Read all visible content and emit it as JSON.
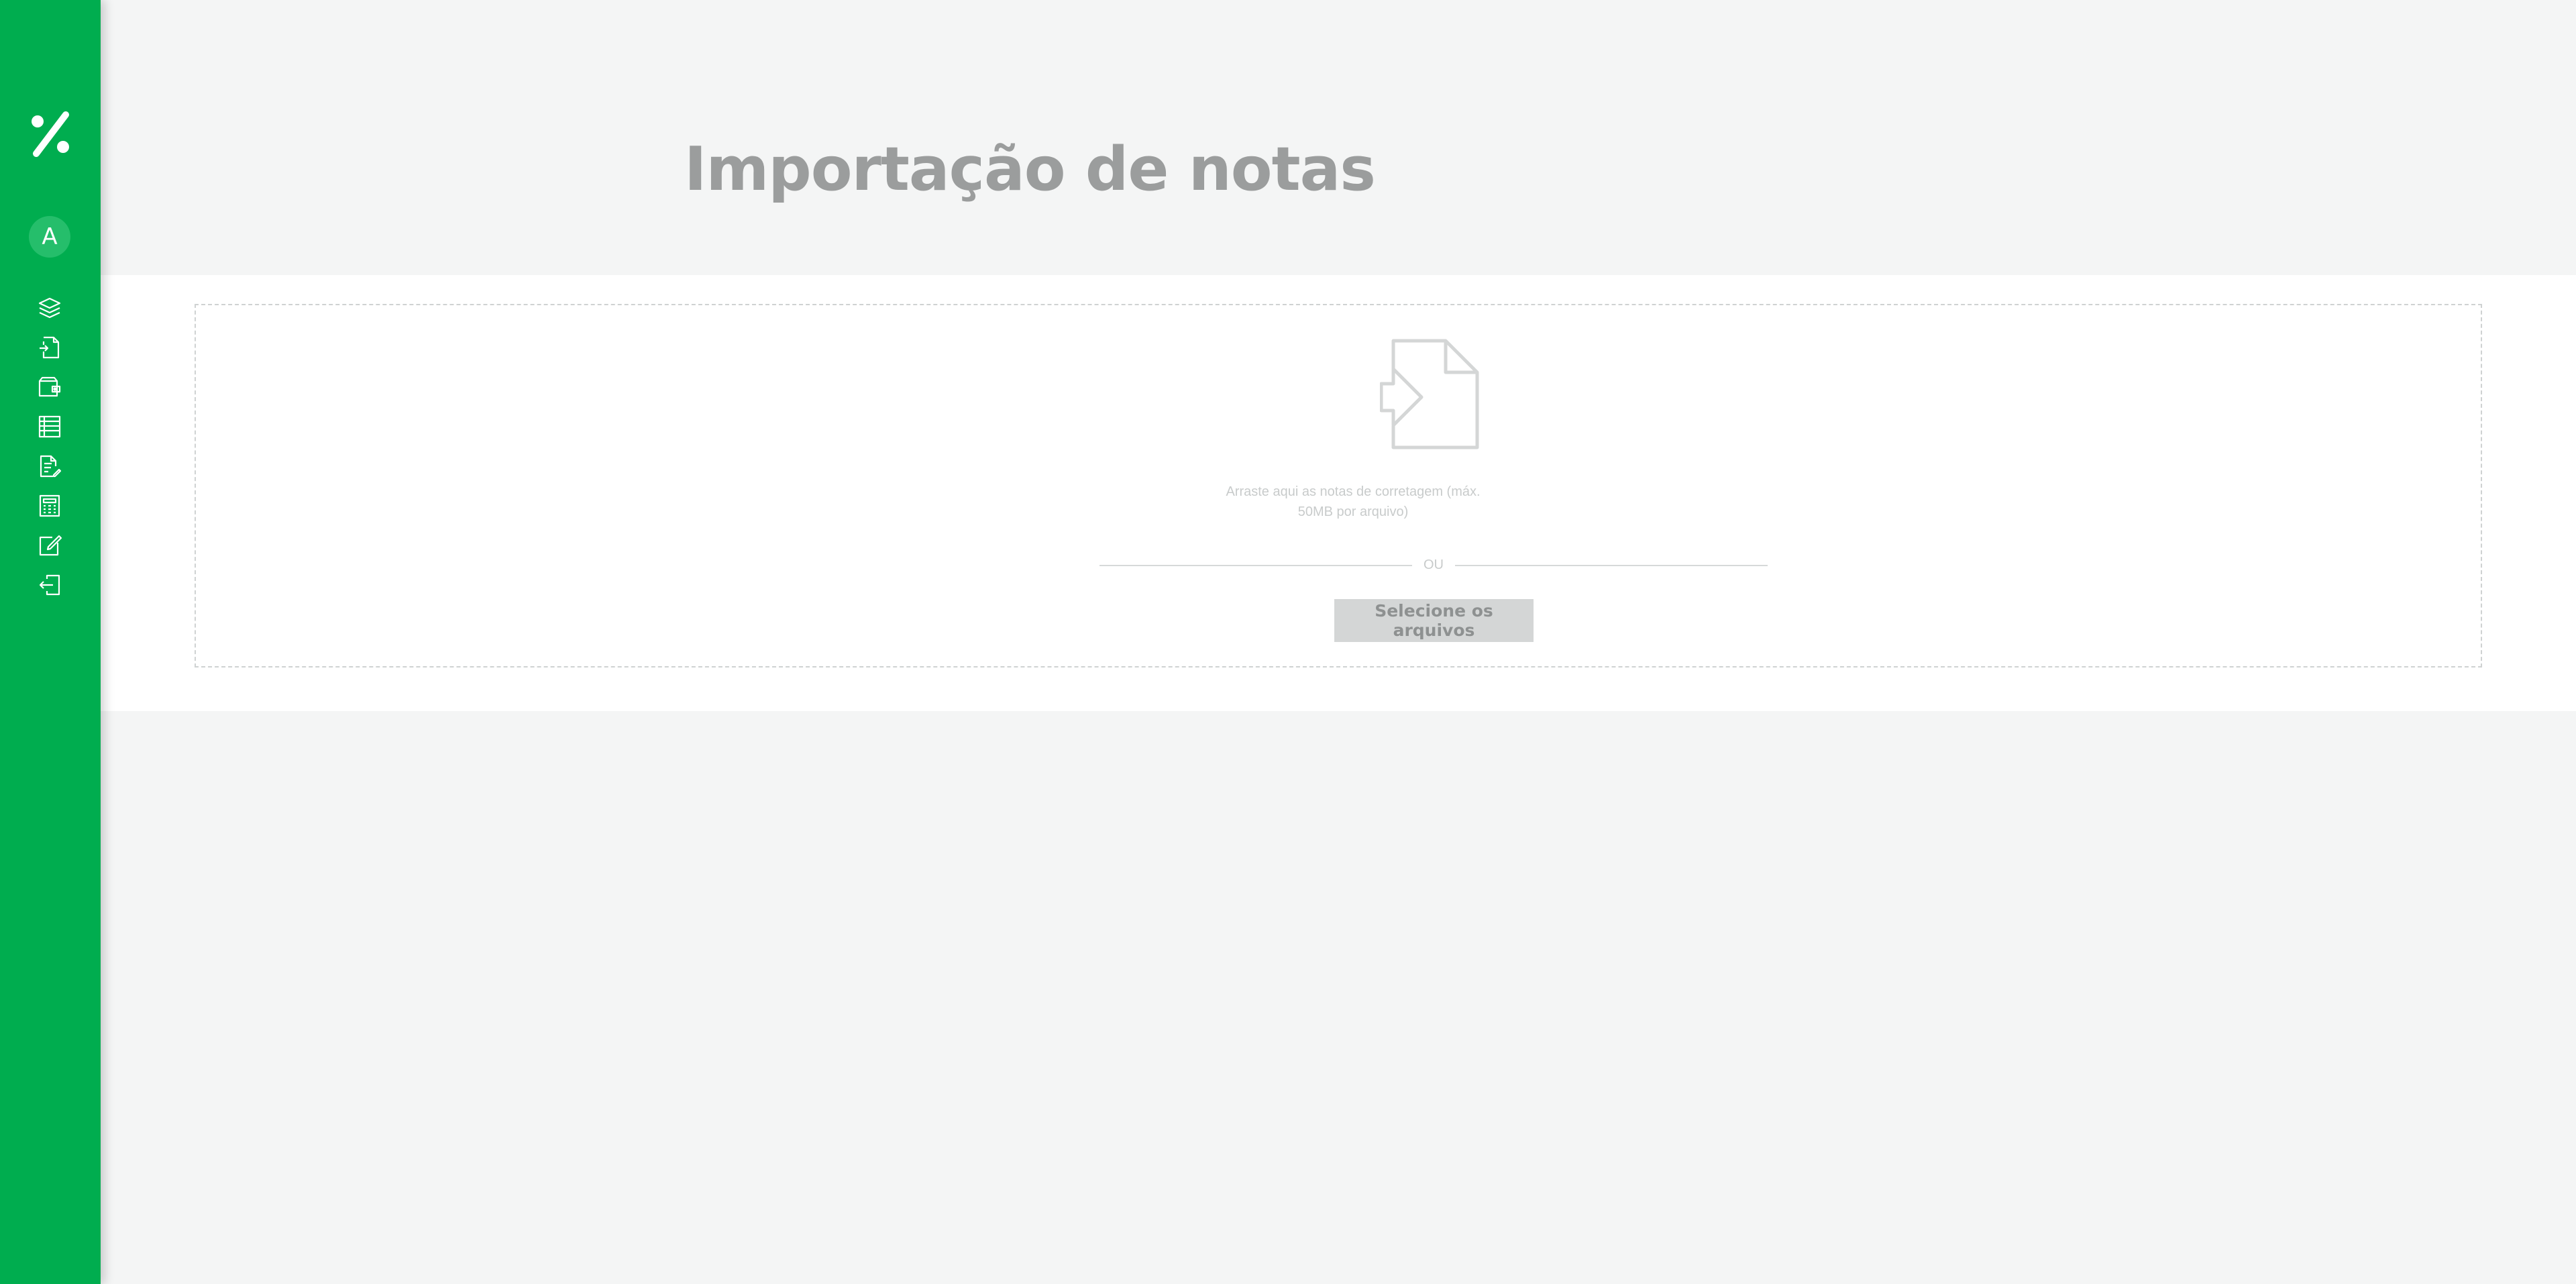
{
  "sidebar": {
    "logo_icon": "percent-logo-icon",
    "avatar_letter": "A",
    "nav_items": [
      {
        "icon": "layers-icon"
      },
      {
        "icon": "document-import-icon"
      },
      {
        "icon": "wallet-icon"
      },
      {
        "icon": "list-table-icon"
      },
      {
        "icon": "document-edit-icon"
      },
      {
        "icon": "calculator-icon"
      },
      {
        "icon": "edit-icon"
      },
      {
        "icon": "logout-icon"
      }
    ],
    "background_color": "#00ad4f"
  },
  "header": {
    "title": "Importação de notas"
  },
  "dropzone": {
    "icon": "file-import-icon",
    "instructions": "Arraste aqui as notas de corretagem (máx. 50MB por arquivo)",
    "divider_label": "OU",
    "select_button_label": "Selecione os arquivos"
  }
}
